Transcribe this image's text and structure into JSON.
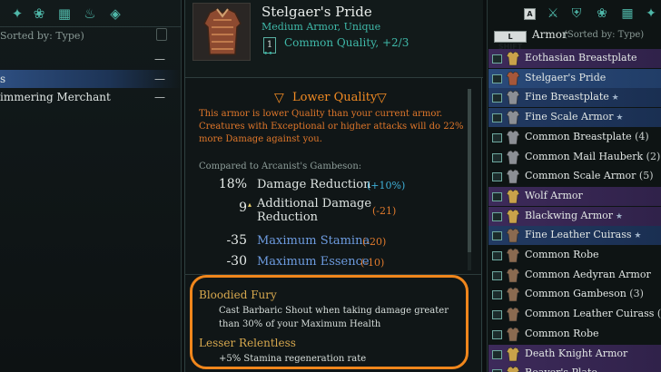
{
  "left_panel": {
    "sorted_label": "Sorted by: Type)",
    "rows": [
      {
        "label": "",
        "dash": "—",
        "selected": false
      },
      {
        "label": "s",
        "dash": "—",
        "selected": true
      },
      {
        "label": "immering Merchant",
        "dash": "—",
        "selected": false
      }
    ]
  },
  "item": {
    "name": "Stelgaer's Pride",
    "type": "Medium Armor, Unique",
    "quality_level": "1",
    "quality_text": "Common Quality, +2/3",
    "quality_dots": "••"
  },
  "lower_quality": {
    "title": "Lower Quality",
    "description": "This armor is lower Quality than your current armor. Creatures with Exceptional or higher attacks will do 22% more Damage against you."
  },
  "compared_to": "Compared to Arcanist's Gambeson:",
  "stats": [
    {
      "value": "18%",
      "label": "Damage Reduction",
      "delta": "(+10%)",
      "dir": "up",
      "label_style": "normal"
    },
    {
      "value": "9",
      "label": "Additional Damage",
      "label2": "Reduction",
      "delta": "(-21)",
      "dir": "down",
      "label_style": "normal"
    },
    {
      "value": "-35",
      "label": "Maximum Stamina",
      "delta": "(-20)",
      "dir": "down",
      "label_style": "blue"
    },
    {
      "value": "-30",
      "label": "Maximum Essence",
      "delta": "(-10)",
      "dir": "down",
      "label_style": "blue"
    }
  ],
  "perks": [
    {
      "title": "Bloodied Fury",
      "description_line1": "Cast Barbaric Shout when taking damage greater",
      "description_line2": "than 30% of your Maximum Health"
    },
    {
      "title": "Lesser Relentless",
      "description_line1": "+5% Stamina regeneration rate",
      "description_line2": ""
    }
  ],
  "right_panel": {
    "key_a": "A",
    "key_shift": "L SHIFT",
    "header": "Armor",
    "header_sub": "(Sorted by: Type)",
    "items": [
      {
        "label": "Eothasian Breastplate",
        "count": "",
        "star": false,
        "style": "purple",
        "icon_color": "#c9a24a"
      },
      {
        "label": "Stelgaer's Pride",
        "count": "",
        "star": false,
        "style": "sel",
        "icon_color": "#a6573a"
      },
      {
        "label": "Fine Breastplate",
        "count": "",
        "star": true,
        "style": "blue",
        "icon_color": "#8c8f95"
      },
      {
        "label": "Fine Scale Armor",
        "count": "",
        "star": true,
        "style": "blue",
        "icon_color": "#8c8f95"
      },
      {
        "label": "Common Breastplate",
        "count": "(4)",
        "star": false,
        "style": "",
        "icon_color": "#8c8f95"
      },
      {
        "label": "Common Mail Hauberk",
        "count": "(2)",
        "star": false,
        "style": "",
        "icon_color": "#8c8f95"
      },
      {
        "label": "Common Scale Armor",
        "count": "(5)",
        "star": false,
        "style": "",
        "icon_color": "#8c8f95"
      },
      {
        "label": "Wolf Armor",
        "count": "",
        "star": false,
        "style": "purple",
        "icon_color": "#c9a24a"
      },
      {
        "label": "Blackwing Armor",
        "count": "",
        "star": true,
        "style": "purple",
        "icon_color": "#c9a24a"
      },
      {
        "label": "Fine Leather Cuirass",
        "count": "",
        "star": true,
        "style": "blue",
        "icon_color": "#8a6a50"
      },
      {
        "label": "Common Robe",
        "count": "",
        "star": false,
        "style": "",
        "icon_color": "#8a6a50"
      },
      {
        "label": "Common Aedyran Armor",
        "count": "",
        "star": false,
        "style": "",
        "icon_color": "#8a6a50"
      },
      {
        "label": "Common Gambeson",
        "count": "(3)",
        "star": false,
        "style": "",
        "icon_color": "#8a6a50"
      },
      {
        "label": "Common Leather Cuirass",
        "count": "(3)",
        "star": false,
        "style": "",
        "icon_color": "#8a6a50"
      },
      {
        "label": "Common Robe",
        "count": "",
        "star": false,
        "style": "",
        "icon_color": "#8a6a50"
      },
      {
        "label": "Death Knight Armor",
        "count": "",
        "star": false,
        "style": "purple",
        "icon_color": "#c9a24a"
      },
      {
        "label": "Reaver's Plate",
        "count": "",
        "star": false,
        "style": "purple",
        "icon_color": "#c9a24a"
      }
    ]
  },
  "colors": {
    "accent_teal": "#3fb9a9",
    "warning_orange": "#f08a23",
    "highlight_orange": "#f0861c",
    "perk_gold": "#d7a84e"
  }
}
